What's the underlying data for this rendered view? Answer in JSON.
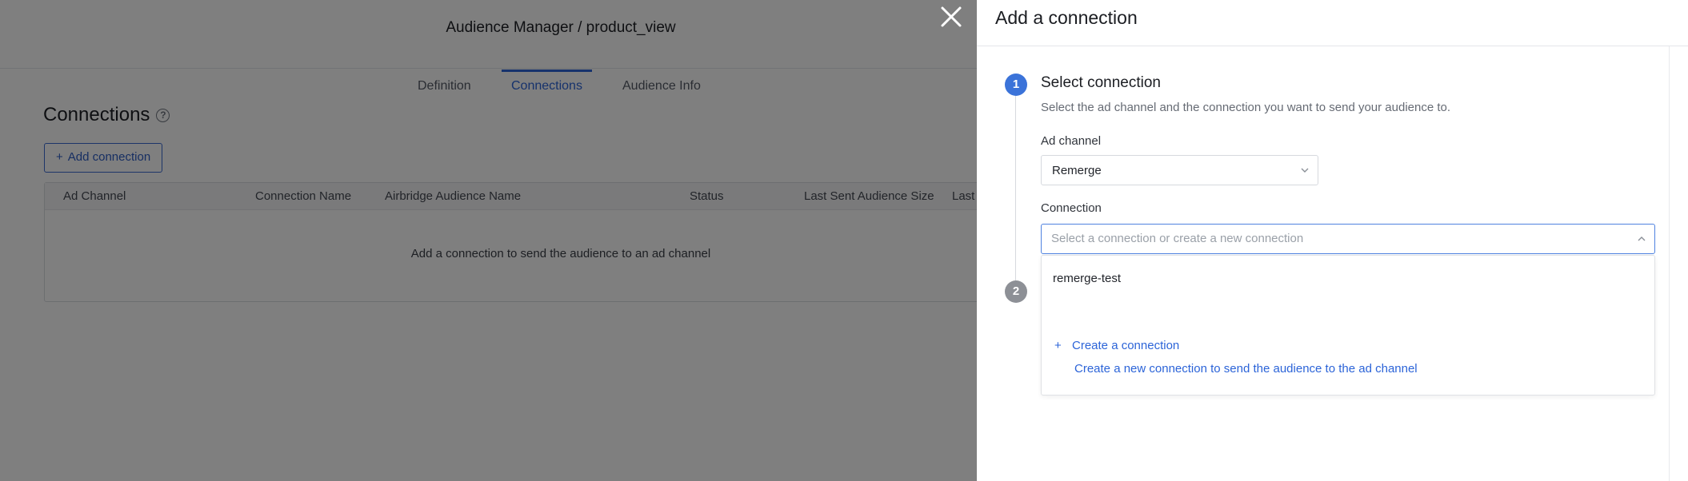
{
  "page": {
    "header_title": "Audience Manager / product_view",
    "tabs": [
      {
        "label": "Definition",
        "active": false
      },
      {
        "label": "Connections",
        "active": true
      },
      {
        "label": "Audience Info",
        "active": false
      }
    ],
    "section_title": "Connections",
    "add_button_label": "Add connection",
    "table": {
      "columns": [
        "Ad Channel",
        "Connection Name",
        "Airbridge Audience Name",
        "Status",
        "Last Sent Audience Size",
        "Last"
      ],
      "empty_message": "Add a connection to send the audience to an ad channel"
    }
  },
  "drawer": {
    "title": "Add a connection",
    "step1": {
      "number": "1",
      "title": "Select connection",
      "description": "Select the ad channel and the connection you want to send your audience to."
    },
    "step2": {
      "number": "2"
    },
    "ad_channel": {
      "label": "Ad channel",
      "value": "Remerge"
    },
    "connection": {
      "label": "Connection",
      "placeholder": "Select a connection or create a new connection",
      "options": [
        "remerge-test"
      ],
      "create_label": "Create a connection",
      "create_description": "Create a new connection to send the audience to the ad channel"
    }
  },
  "colors": {
    "accent": "#2c64d8",
    "overlay": "rgba(0,0,0,0.5)",
    "step_active": "#3b73d9",
    "step_inactive": "#8d9096"
  },
  "icons": [
    "help-icon",
    "plus-icon",
    "close-icon",
    "chevron-down-icon",
    "chevron-up-icon"
  ]
}
